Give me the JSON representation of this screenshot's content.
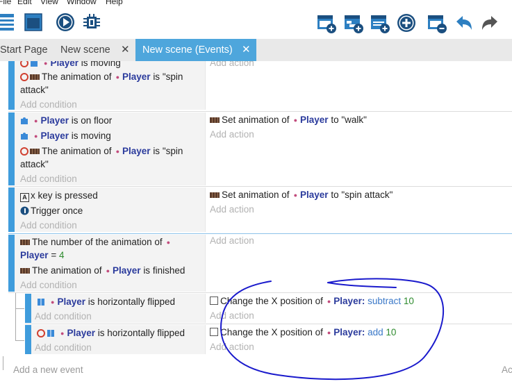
{
  "menu": [
    "File",
    "Edit",
    "View",
    "Window",
    "Help"
  ],
  "tabs": [
    {
      "label": "Start Page"
    },
    {
      "label": "New scene",
      "close": "✕"
    },
    {
      "label": "New scene (Events)",
      "close": "✕"
    }
  ],
  "events": {
    "e1": {
      "c1_obj": "Player",
      "c1_txt": "is moving",
      "c2_pre": "The animation of",
      "c2_obj": "Player",
      "c2_post": "is \"spin",
      "c2_cont": "attack\"",
      "add_condition": "Add condition",
      "add_action": "Add action"
    },
    "e2": {
      "c1_obj": "Player",
      "c1_txt": "is on floor",
      "c2_obj": "Player",
      "c2_txt": "is moving",
      "c3_pre": "The animation of",
      "c3_obj": "Player",
      "c3_post": "is \"spin",
      "c3_cont": "attack\"",
      "add_condition": "Add condition",
      "a1_pre": "Set animation of",
      "a1_obj": "Player",
      "a1_post": "to \"walk\"",
      "add_action": "Add action"
    },
    "e3": {
      "c1_key": "A",
      "c1_txt": "x key is pressed",
      "c2_txt": "Trigger once",
      "add_condition": "Add condition",
      "a1_pre": "Set animation of",
      "a1_obj": "Player",
      "a1_post": "to \"spin attack\"",
      "add_action": "Add action"
    },
    "e4": {
      "c1_pre": "The number of the animation of",
      "c1_obj": "Player",
      "c1_op": "=",
      "c1_val": "4",
      "c2_pre": "The animation of",
      "c2_obj": "Player",
      "c2_post": "is finished",
      "add_condition": "Add condition",
      "add_action": "Add action"
    },
    "sub1": {
      "c1_obj": "Player",
      "c1_txt": "is horizontally flipped",
      "add_condition": "Add condition",
      "a1_pre": "Change the X position of",
      "a1_obj": "Player:",
      "a1_op": "subtract",
      "a1_val": "10",
      "add_action": "Add action"
    },
    "sub2": {
      "c1_obj": "Player",
      "c1_txt": "is horizontally flipped",
      "add_condition": "Add condition",
      "a1_pre": "Change the X position of",
      "a1_obj": "Player:",
      "a1_op": "add",
      "a1_val": "10",
      "add_action": "Add action"
    }
  },
  "footer": {
    "add_event": "Add a new event",
    "add_right": "Ac"
  },
  "colors": {
    "accent": "#3f9cdc",
    "tab_active": "#4ea6dc",
    "object": "#2a3a9c",
    "number": "#2e8b2e",
    "annotation": "#1a1acc"
  }
}
